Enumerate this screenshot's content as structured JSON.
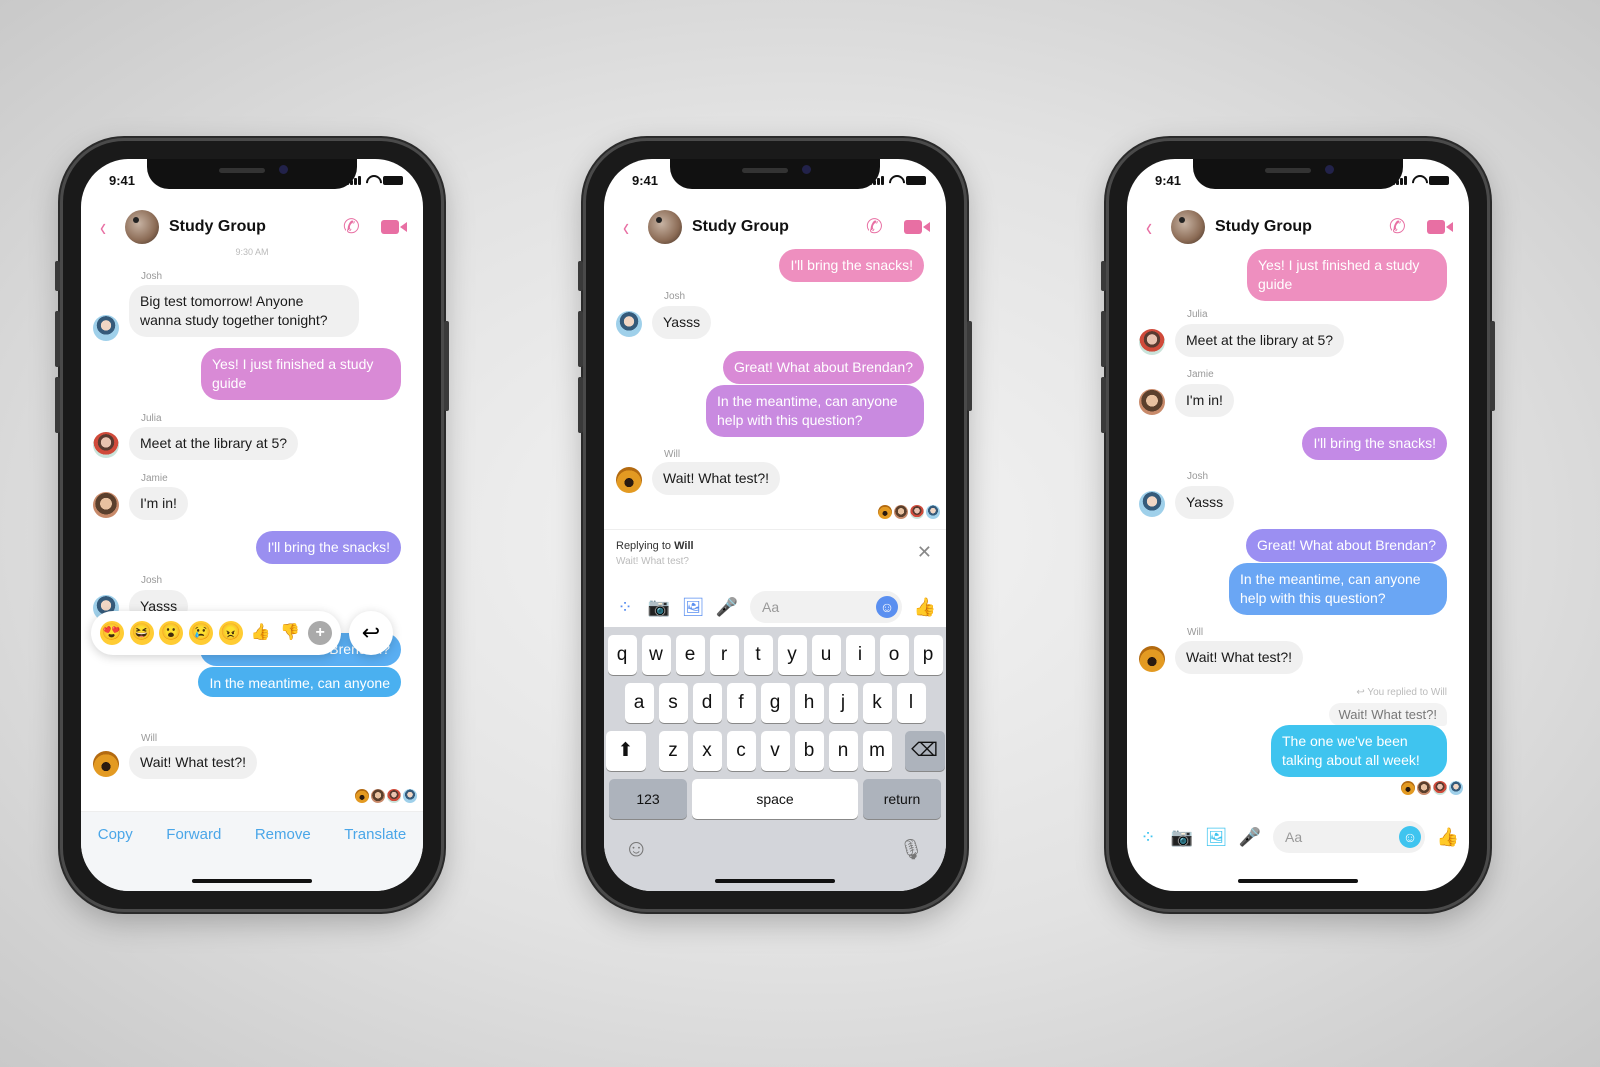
{
  "status": {
    "time": "9:41"
  },
  "header": {
    "title": "Study Group",
    "back": "‹",
    "phone": "✆"
  },
  "colors": {
    "accent_pink": "#e86fa3",
    "blue": "#4aa6e8",
    "cyan": "#3fc4ef"
  },
  "phone1": {
    "timestamp": "9:30 AM",
    "messages": [
      {
        "sender": "Josh",
        "text": "Big test tomorrow! Anyone wanna study together tonight?"
      },
      {
        "text": "Yes! I just finished a study guide"
      },
      {
        "sender": "Julia",
        "text": "Meet at the library at 5?"
      },
      {
        "sender": "Jamie",
        "text": "I'm in!"
      },
      {
        "text": "I'll bring the snacks!"
      },
      {
        "sender": "Josh",
        "text": "Yasss"
      },
      {
        "text": "Great! What about Brendan?"
      },
      {
        "text": "In the meantime, can anyone"
      },
      {
        "sender": "Will",
        "text": "Wait! What test?!"
      }
    ],
    "reactions": [
      "😍",
      "😆",
      "😮",
      "😢",
      "😠",
      "👍",
      "👎",
      "+"
    ],
    "reply_icon": "↩",
    "actions": [
      "Copy",
      "Forward",
      "Remove",
      "Translate"
    ]
  },
  "phone2": {
    "messages": [
      {
        "text": "I'll bring the snacks!"
      },
      {
        "sender": "Josh",
        "text": "Yasss"
      },
      {
        "text": "Great! What about Brendan?"
      },
      {
        "text": "In the meantime, can anyone help with this question?"
      },
      {
        "sender": "Will",
        "text": "Wait! What test?!"
      }
    ],
    "replying_label": "Replying to",
    "replying_name": "Will",
    "replying_preview": "Wait! What test?",
    "close": "✕",
    "composer_placeholder": "Aa",
    "keyboard": {
      "row1": [
        "q",
        "w",
        "e",
        "r",
        "t",
        "y",
        "u",
        "i",
        "o",
        "p"
      ],
      "row2": [
        "a",
        "s",
        "d",
        "f",
        "g",
        "h",
        "j",
        "k",
        "l"
      ],
      "row3": [
        "z",
        "x",
        "c",
        "v",
        "b",
        "n",
        "m"
      ],
      "shift": "⬆",
      "delete": "⌫",
      "numbers": "123",
      "space": "space",
      "return": "return",
      "emoji": "☺",
      "mic": "🎙"
    }
  },
  "phone3": {
    "messages": [
      {
        "text": "Yes! I just finished a study guide"
      },
      {
        "sender": "Julia",
        "text": "Meet at the library at 5?"
      },
      {
        "sender": "Jamie",
        "text": "I'm in!"
      },
      {
        "text": "I'll bring the snacks!"
      },
      {
        "sender": "Josh",
        "text": "Yasss"
      },
      {
        "text": "Great! What about Brendan?"
      },
      {
        "text": "In the meantime, can anyone help with this question?"
      },
      {
        "sender": "Will",
        "text": "Wait! What test?!"
      }
    ],
    "replied_label": "You replied to Will",
    "quoted": "Wait! What test?!",
    "reply": "The one we've been talking about all week!",
    "composer_placeholder": "Aa"
  }
}
